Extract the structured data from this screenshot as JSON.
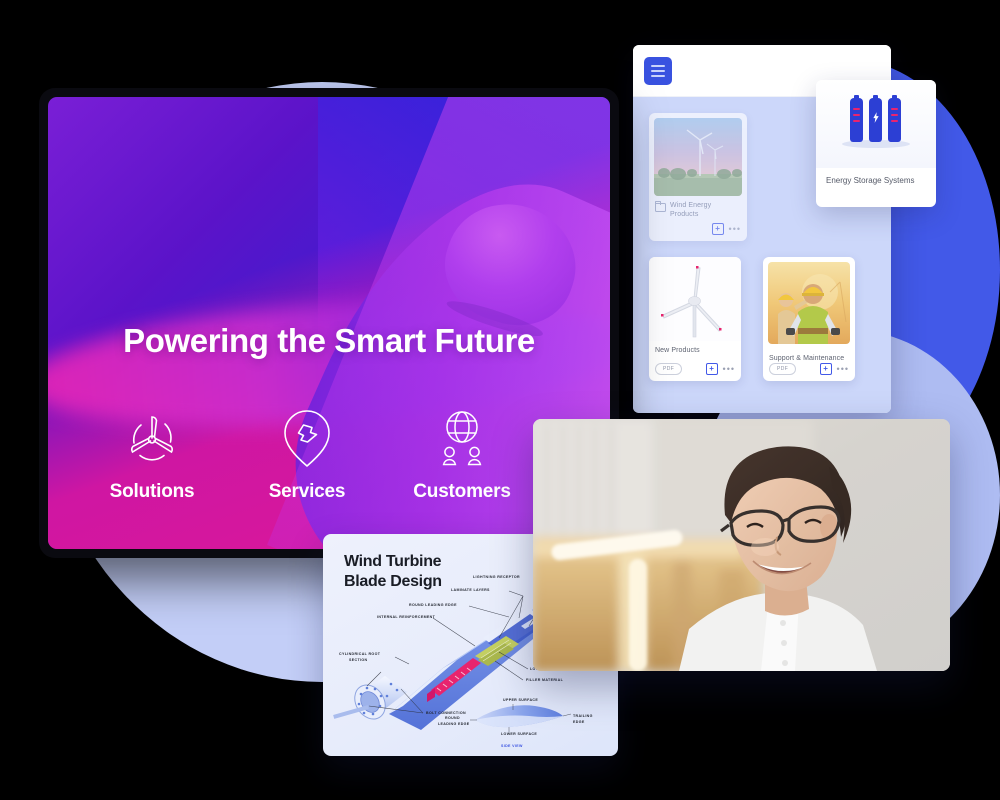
{
  "hero": {
    "title": "Powering the Smart Future",
    "icons": [
      {
        "label": "Solutions",
        "icon": "wind-turbine-rotor-icon"
      },
      {
        "label": "Services",
        "icon": "location-pin-lightning-icon"
      },
      {
        "label": "Customers",
        "icon": "globe-people-icon"
      }
    ]
  },
  "app_panel": {
    "menu_button_icon": "hamburger-menu-icon",
    "cards": [
      {
        "title": "Wind Energy Products",
        "thumb": "wind-farm-sunset-photo",
        "leading_icon": "folder-icon",
        "badge": null,
        "add_label": "+",
        "more_label": "•••"
      },
      {
        "title": "New Products",
        "thumb": "wind-turbine-3d-render",
        "leading_icon": null,
        "badge": "PDF",
        "add_label": "+",
        "more_label": "•••"
      },
      {
        "title": "Support & Maintenance",
        "thumb": "field-technicians-sunset-illustration",
        "leading_icon": null,
        "badge": "PDF",
        "add_label": "+",
        "more_label": "•••"
      }
    ]
  },
  "energy_card": {
    "title": "Energy Storage Systems",
    "illustration": "battery-cells-icon"
  },
  "blade_card": {
    "title_line1": "Wind Turbine",
    "title_line2": "Blade Design",
    "labels": {
      "lightning_receptor": "LIGHTNING RECEPTOR",
      "laminate_layers": "LAMINATE LAYERS",
      "round_leading_edge": "ROUND LEADING EDGE",
      "internal_reinforcement": "INTERNAL REINFORCEMENT",
      "cylindrical_root_section_l1": "CYLINDRICAL ROOT",
      "cylindrical_root_section_l2": "SECTION",
      "bolt_connection": "BOLT CONNECTION",
      "lower_surface_callout": "LOWER SURFACE",
      "filler_material": "FILLER MATERIAL",
      "upper_surface": "UPPER SURFACE",
      "lower_surface": "LOWER SURFACE",
      "round_leading_edge_l1": "ROUND",
      "round_leading_edge_l2": "LEADING EDGE",
      "trailing_edge_l1": "TRAILING",
      "trailing_edge_l2": "EDGE",
      "side_view": "SIDE VIEW"
    }
  },
  "photo_card": {
    "alt": "smiling-person-with-glasses-portrait"
  },
  "colors": {
    "brand_blue": "#3952e0",
    "accent_magenta": "#e8246e",
    "hero_gradient_start": "#7a1fd6",
    "hero_gradient_end": "#2f2fe0",
    "panel_bg": "#ccd7fa",
    "lavender_blob": "#c3cef7",
    "blue_blob": "#4259e8"
  }
}
